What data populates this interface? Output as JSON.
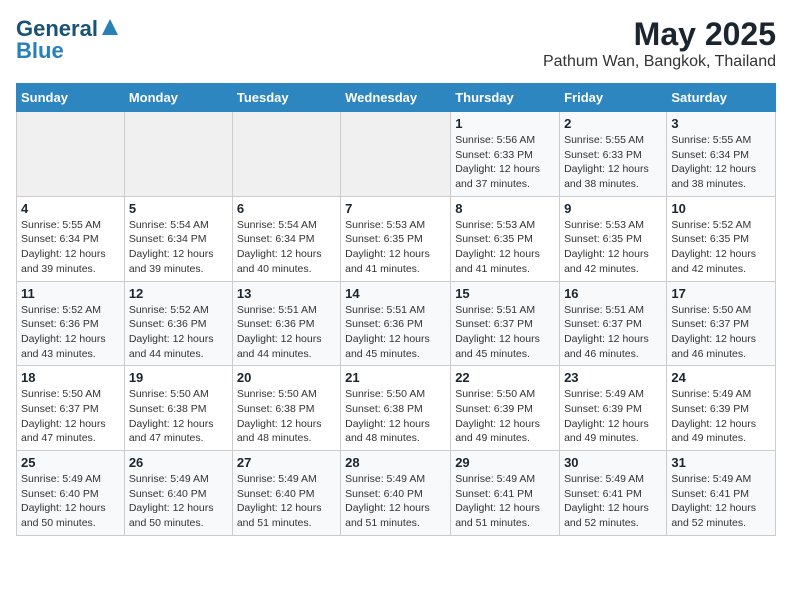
{
  "header": {
    "logo_line1": "General",
    "logo_line2": "Blue",
    "month_year": "May 2025",
    "location": "Pathum Wan, Bangkok, Thailand"
  },
  "days_of_week": [
    "Sunday",
    "Monday",
    "Tuesday",
    "Wednesday",
    "Thursday",
    "Friday",
    "Saturday"
  ],
  "weeks": [
    [
      {
        "day": "",
        "info": ""
      },
      {
        "day": "",
        "info": ""
      },
      {
        "day": "",
        "info": ""
      },
      {
        "day": "",
        "info": ""
      },
      {
        "day": "1",
        "info": "Sunrise: 5:56 AM\nSunset: 6:33 PM\nDaylight: 12 hours\nand 37 minutes."
      },
      {
        "day": "2",
        "info": "Sunrise: 5:55 AM\nSunset: 6:33 PM\nDaylight: 12 hours\nand 38 minutes."
      },
      {
        "day": "3",
        "info": "Sunrise: 5:55 AM\nSunset: 6:34 PM\nDaylight: 12 hours\nand 38 minutes."
      }
    ],
    [
      {
        "day": "4",
        "info": "Sunrise: 5:55 AM\nSunset: 6:34 PM\nDaylight: 12 hours\nand 39 minutes."
      },
      {
        "day": "5",
        "info": "Sunrise: 5:54 AM\nSunset: 6:34 PM\nDaylight: 12 hours\nand 39 minutes."
      },
      {
        "day": "6",
        "info": "Sunrise: 5:54 AM\nSunset: 6:34 PM\nDaylight: 12 hours\nand 40 minutes."
      },
      {
        "day": "7",
        "info": "Sunrise: 5:53 AM\nSunset: 6:35 PM\nDaylight: 12 hours\nand 41 minutes."
      },
      {
        "day": "8",
        "info": "Sunrise: 5:53 AM\nSunset: 6:35 PM\nDaylight: 12 hours\nand 41 minutes."
      },
      {
        "day": "9",
        "info": "Sunrise: 5:53 AM\nSunset: 6:35 PM\nDaylight: 12 hours\nand 42 minutes."
      },
      {
        "day": "10",
        "info": "Sunrise: 5:52 AM\nSunset: 6:35 PM\nDaylight: 12 hours\nand 42 minutes."
      }
    ],
    [
      {
        "day": "11",
        "info": "Sunrise: 5:52 AM\nSunset: 6:36 PM\nDaylight: 12 hours\nand 43 minutes."
      },
      {
        "day": "12",
        "info": "Sunrise: 5:52 AM\nSunset: 6:36 PM\nDaylight: 12 hours\nand 44 minutes."
      },
      {
        "day": "13",
        "info": "Sunrise: 5:51 AM\nSunset: 6:36 PM\nDaylight: 12 hours\nand 44 minutes."
      },
      {
        "day": "14",
        "info": "Sunrise: 5:51 AM\nSunset: 6:36 PM\nDaylight: 12 hours\nand 45 minutes."
      },
      {
        "day": "15",
        "info": "Sunrise: 5:51 AM\nSunset: 6:37 PM\nDaylight: 12 hours\nand 45 minutes."
      },
      {
        "day": "16",
        "info": "Sunrise: 5:51 AM\nSunset: 6:37 PM\nDaylight: 12 hours\nand 46 minutes."
      },
      {
        "day": "17",
        "info": "Sunrise: 5:50 AM\nSunset: 6:37 PM\nDaylight: 12 hours\nand 46 minutes."
      }
    ],
    [
      {
        "day": "18",
        "info": "Sunrise: 5:50 AM\nSunset: 6:37 PM\nDaylight: 12 hours\nand 47 minutes."
      },
      {
        "day": "19",
        "info": "Sunrise: 5:50 AM\nSunset: 6:38 PM\nDaylight: 12 hours\nand 47 minutes."
      },
      {
        "day": "20",
        "info": "Sunrise: 5:50 AM\nSunset: 6:38 PM\nDaylight: 12 hours\nand 48 minutes."
      },
      {
        "day": "21",
        "info": "Sunrise: 5:50 AM\nSunset: 6:38 PM\nDaylight: 12 hours\nand 48 minutes."
      },
      {
        "day": "22",
        "info": "Sunrise: 5:50 AM\nSunset: 6:39 PM\nDaylight: 12 hours\nand 49 minutes."
      },
      {
        "day": "23",
        "info": "Sunrise: 5:49 AM\nSunset: 6:39 PM\nDaylight: 12 hours\nand 49 minutes."
      },
      {
        "day": "24",
        "info": "Sunrise: 5:49 AM\nSunset: 6:39 PM\nDaylight: 12 hours\nand 49 minutes."
      }
    ],
    [
      {
        "day": "25",
        "info": "Sunrise: 5:49 AM\nSunset: 6:40 PM\nDaylight: 12 hours\nand 50 minutes."
      },
      {
        "day": "26",
        "info": "Sunrise: 5:49 AM\nSunset: 6:40 PM\nDaylight: 12 hours\nand 50 minutes."
      },
      {
        "day": "27",
        "info": "Sunrise: 5:49 AM\nSunset: 6:40 PM\nDaylight: 12 hours\nand 51 minutes."
      },
      {
        "day": "28",
        "info": "Sunrise: 5:49 AM\nSunset: 6:40 PM\nDaylight: 12 hours\nand 51 minutes."
      },
      {
        "day": "29",
        "info": "Sunrise: 5:49 AM\nSunset: 6:41 PM\nDaylight: 12 hours\nand 51 minutes."
      },
      {
        "day": "30",
        "info": "Sunrise: 5:49 AM\nSunset: 6:41 PM\nDaylight: 12 hours\nand 52 minutes."
      },
      {
        "day": "31",
        "info": "Sunrise: 5:49 AM\nSunset: 6:41 PM\nDaylight: 12 hours\nand 52 minutes."
      }
    ]
  ]
}
